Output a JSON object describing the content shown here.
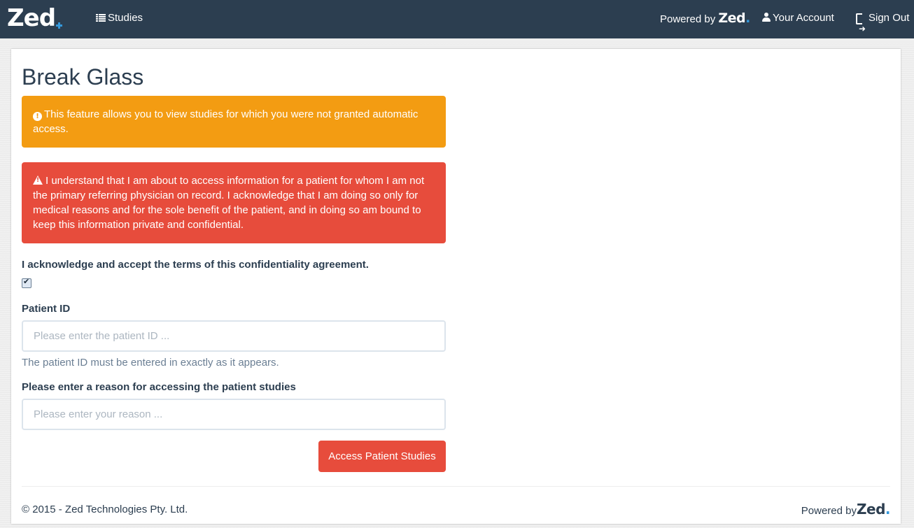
{
  "navbar": {
    "brand": "Zed",
    "studies_label": "Studies",
    "powered_by_label": "Powered by",
    "powered_by_brand": "Zed",
    "powered_by_dot": ".",
    "account_label": "Your Account",
    "signout_label": "Sign Out"
  },
  "page": {
    "title": "Break Glass"
  },
  "alerts": {
    "warning_text": "This feature allows you to view studies for which you were not granted automatic access.",
    "danger_text": "I understand that I am about to access information for a patient for whom I am not the primary referring physician on record. I acknowledge that I am doing so only for medical reasons and for the sole benefit of the patient, and in doing so am bound to keep this information private and confidential."
  },
  "form": {
    "ack_label": "I acknowledge and accept the terms of this confidentiality agreement.",
    "ack_checked": true,
    "patient_id_label": "Patient ID",
    "patient_id_value": "",
    "patient_id_placeholder": "Please enter the patient ID ...",
    "patient_id_help": "The patient ID must be entered in exactly as it appears.",
    "reason_label": "Please enter a reason for accessing the patient studies",
    "reason_value": "",
    "reason_placeholder": "Please enter your reason ...",
    "submit_label": "Access Patient Studies"
  },
  "footer": {
    "copyright": "© 2015 - Zed Technologies Pty. Ltd.",
    "powered_by_label": "Powered by",
    "powered_by_brand": "Zed",
    "powered_by_dot": "."
  },
  "colors": {
    "navbar_bg": "#2c3e50",
    "warning": "#f39c12",
    "danger": "#e74c3c",
    "accent": "#3498db"
  }
}
